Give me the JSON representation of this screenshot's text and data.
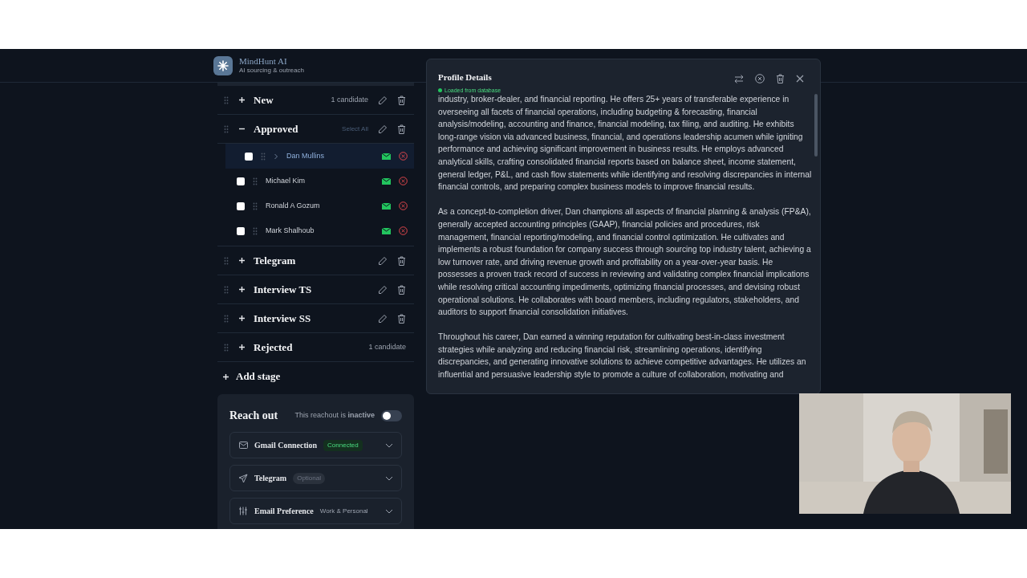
{
  "app": {
    "name": "MindHunt AI",
    "tagline": "AI sourcing & outreach"
  },
  "stages": [
    {
      "name": "New",
      "expanded": false,
      "count": "1 candidate",
      "editable": true
    },
    {
      "name": "Approved",
      "expanded": true,
      "action": "Select All",
      "editable": true,
      "candidates": [
        {
          "name": "Dan Mullins",
          "selected": true,
          "checked": false
        },
        {
          "name": "Michael Kim",
          "selected": false,
          "checked": false
        },
        {
          "name": "Ronald A Gozum",
          "selected": false,
          "checked": false
        },
        {
          "name": "Mark Shalhoub",
          "selected": false,
          "checked": false
        }
      ]
    },
    {
      "name": "Telegram",
      "expanded": false,
      "editable": true
    },
    {
      "name": "Interview TS",
      "expanded": false,
      "editable": true
    },
    {
      "name": "Interview SS",
      "expanded": false,
      "editable": true
    },
    {
      "name": "Rejected",
      "expanded": false,
      "count": "1 candidate",
      "editable": false
    }
  ],
  "add_stage": "Add stage",
  "reach_out": {
    "title": "Reach out",
    "status": "This reachout is **inactive**",
    "on": false,
    "sections": [
      {
        "kind": "gmail",
        "title": "Gmail Connection",
        "badge": "Connected"
      },
      {
        "kind": "telegram",
        "title": "Telegram",
        "badge": "Optional"
      },
      {
        "kind": "preference",
        "title": "Email Preference",
        "badge": "Work & Personal"
      }
    ]
  },
  "profile": {
    "title": "Profile Details",
    "status": "Loaded from database",
    "paragraphs": [
      "industry, broker-dealer, and financial reporting. He offers 25+ years of transferable experience in overseeing all facets of financial operations, including budgeting & forecasting, financial analysis/modeling, accounting and finance, financial modeling, tax filing, and auditing. He exhibits long-range vision via advanced business, financial, and operations leadership acumen while igniting performance and achieving significant improvement in business results. He employs advanced analytical skills, crafting consolidated financial reports based on balance sheet, income statement, general ledger, P&L, and cash flow statements while identifying and resolving discrepancies in internal financial controls, and preparing complex business models to improve financial results.",
      "As a concept-to-completion driver, Dan champions all aspects of financial planning & analysis (FP&A), generally accepted accounting principles (GAAP), financial policies and procedures, risk management, financial reporting/modeling, and financial control optimization. He cultivates and implements a robust foundation for company success through sourcing top industry talent, achieving a low turnover rate, and driving revenue growth and profitability on a year-over-year basis. He possesses a proven track record of success in reviewing and validating complex financial implications while resolving critical accounting impediments, optimizing financial processes, and devising robust operational solutions. He collaborates with board members, including regulators, stakeholders, and auditors to support financial consolidation initiatives.",
      "Throughout his career, Dan earned a winning reputation for cultivating best-in-class investment strategies while analyzing and reducing financial risk, streamlining operations, identifying discrepancies, and generating innovative solutions to achieve competitive advantages. He utilizes an influential and persuasive leadership style to promote a culture of collaboration, motivating and"
    ]
  }
}
